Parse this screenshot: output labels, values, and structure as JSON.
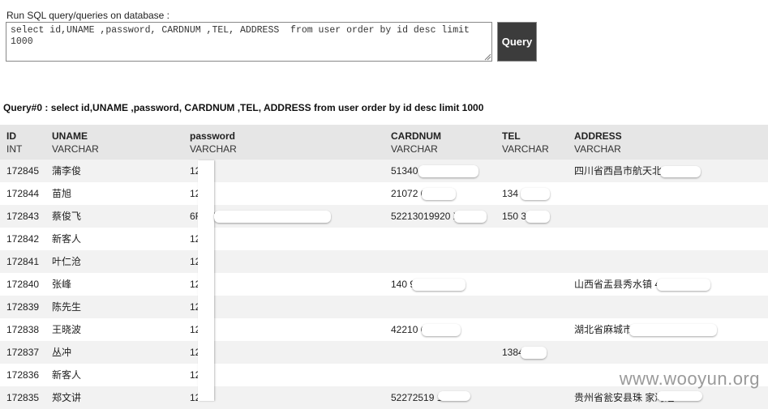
{
  "form": {
    "label": "Run SQL query/queries on database :",
    "sql": "select id,UNAME ,password, CARDNUM ,TEL, ADDRESS  from user order by id desc limit\n1000",
    "button": "Query"
  },
  "result": {
    "title": "Query#0 : select id,UNAME ,password, CARDNUM ,TEL, ADDRESS from user order by id desc limit 1000",
    "columns": [
      {
        "name": "ID",
        "type": "INT"
      },
      {
        "name": "UNAME",
        "type": "VARCHAR"
      },
      {
        "name": "password",
        "type": "VARCHAR"
      },
      {
        "name": "CARDNUM",
        "type": "VARCHAR"
      },
      {
        "name": "TEL",
        "type": "VARCHAR"
      },
      {
        "name": "ADDRESS",
        "type": "VARCHAR"
      }
    ],
    "rows": [
      [
        "172845",
        "蒲李俊",
        "12   56",
        "51340           19",
        "",
        "四川省西昌市航天北"
      ],
      [
        "172844",
        "苗旭",
        "12   56",
        "21072         082116",
        "134      75",
        ""
      ],
      [
        "172843",
        "蔡俊飞",
        "6F  AC5                8226D1C5",
        "52213019920        X",
        "150      362",
        ""
      ],
      [
        "172842",
        "新客人",
        "12   56",
        "",
        "",
        ""
      ],
      [
        "172841",
        "叶仁沧",
        "12   56",
        "",
        "",
        ""
      ],
      [
        "172840",
        "张峰",
        "12   56",
        "140           9067536",
        "",
        "山西省盂县秀水镇               44"
      ],
      [
        "172839",
        "陈先生",
        "12   56",
        "",
        "",
        ""
      ],
      [
        "172838",
        "王晓波",
        "12   56",
        "42210           60416",
        "",
        "湖北省麻城市                    红石堰坑"
      ],
      [
        "172837",
        "丛冲",
        "12   56",
        "",
        "1384     080",
        ""
      ],
      [
        "172836",
        "新客人",
        "12   56",
        "",
        "",
        ""
      ],
      [
        "172835",
        "郑文讲",
        "12   56",
        "52272519          112",
        "",
        "贵州省瓮安县珠             家湾组"
      ]
    ]
  },
  "watermark": "www.wooyun.org"
}
